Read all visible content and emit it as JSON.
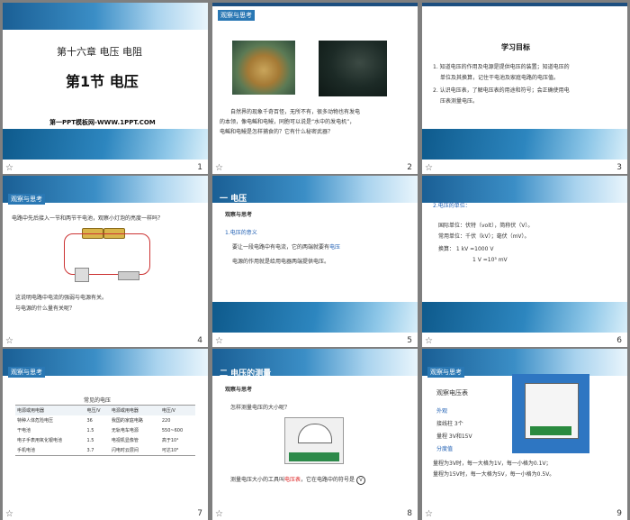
{
  "slides": [
    {
      "num": "1",
      "title": "第十六章 电压 电阻",
      "subtitle": "第1节  电压",
      "site": "第一PPT模板网-WWW.1PPT.COM"
    },
    {
      "num": "2",
      "tag": "观察与思考",
      "text1": "自然界的现象千奇百怪，无所不有，很多动物也有发电",
      "text2": "的本领，像电鳐和电鳗，同胞可以说是“水中的发电机”，",
      "text3": "电鳐和电鳗是怎样捕食的？它有什么秘密武器？"
    },
    {
      "num": "3",
      "heading": "学习目标",
      "l1": "1. 知道电压的作用及电源是提供电压的装置；知道电压的",
      "l2": "单位及其换算，记住干电池及家庭电路的电压值。",
      "l3": "2. 认识电压表，了解电压表的用途和符号；会正确使用电",
      "l4": "压表测量电压。"
    },
    {
      "num": "4",
      "tag": "观察与思考",
      "q": "电路中先后接入一节和两节干电池，观察小灯泡的亮度一样吗？",
      "c1": "这说明电路中电流的强弱与电源有关。",
      "c2": "与电源的什么量有关呢？"
    },
    {
      "num": "5",
      "section": "一  电压",
      "tag": "观察与思考",
      "p1": "1.电压的意义",
      "p2": "要让一段电路中有电流，它的两端就要有",
      "kw": "电压",
      "p3": "电源的作用就是给用电器两端提供电压。"
    },
    {
      "num": "6",
      "u0": "2.电压的单位：",
      "u1": "国际单位：伏特（volt），简称伏（V）。",
      "u2": "常用单位：千伏（kV）；毫伏（mV）。",
      "u3": "换算：      1 kV =1000 V",
      "u4": "1 V  =10³ mV"
    },
    {
      "num": "7",
      "tag": "观察与思考",
      "tableTitle": "常见的电压",
      "headers": [
        "电源或用电器",
        "电压/V",
        "电源或用电器",
        "电压/V"
      ],
      "rows": [
        [
          "特种人体危险电压",
          "36",
          "我国的家庭电路",
          "220"
        ],
        [
          "干电池",
          "1.5",
          "无轨电车电源",
          "550~600"
        ],
        [
          "电子手表用氧化银电池",
          "1.5",
          "电视机显像管",
          "高于10⁴"
        ],
        [
          "手机电池",
          "3.7",
          "闪电时云层间",
          "可达10⁸"
        ]
      ]
    },
    {
      "num": "8",
      "section": "二  电压的测量",
      "tag": "观察与思考",
      "q": "怎样测量电压的大小呢？",
      "tool1": "测量电压大小的工具叫",
      "tool2": "电压表",
      "tool3": "，它在电路中的符号是",
      "sym": "V"
    },
    {
      "num": "9",
      "tag": "观察与思考",
      "title": "观察电压表",
      "a1": "外观",
      "a2": "接线柱  3个",
      "a3": "量程  3V和15V",
      "a4": "分度值",
      "r1": "量程为3V时，每一大格为1V，每一小格为0.1V；",
      "r2": "量程为15V时，每一大格为5V，每一小格为0.5V。"
    }
  ]
}
